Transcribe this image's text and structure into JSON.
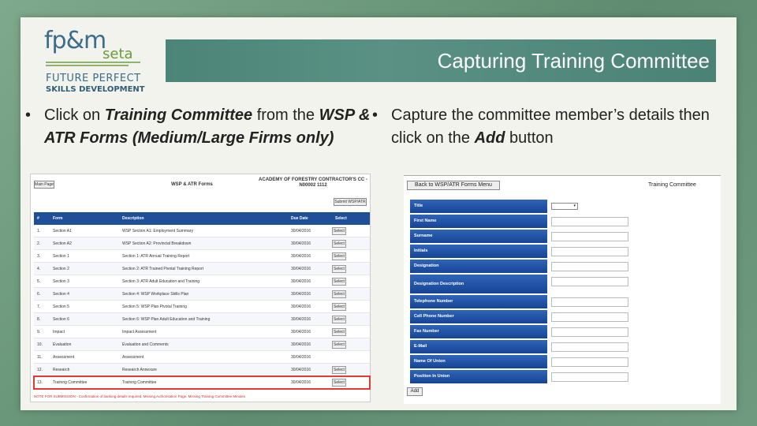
{
  "logo": {
    "brand": "fp&m",
    "seta": "seta",
    "line1": "FUTURE PERFECT",
    "line2": "SKILLS DEVELOPMENT"
  },
  "title": "Capturing Training Committee",
  "bullets": {
    "left": {
      "pre": "Click on ",
      "em1": "Training Committee",
      "mid": " from the ",
      "em2": "WSP & ATR Forms (Medium/Large Firms only)"
    },
    "right": {
      "pre": "Capture the committee member’s details then click on the ",
      "em": "Add",
      "post": " button"
    }
  },
  "left_screen": {
    "main_page_button": "Main Page",
    "header_title": "WSP & ATR Forms",
    "org_name": "ACADEMY OF FORESTRY CONTRACTOR'S CC - N00002 1112",
    "submit_button": "Submit WSP/ATR",
    "columns": [
      "#",
      "Form",
      "Description",
      "Due Date",
      "Select"
    ],
    "rows": [
      {
        "n": "1.",
        "form": "Section A1",
        "desc": "WSP Section A1: Employment Summary",
        "due": "30/04/2016",
        "select": "Select"
      },
      {
        "n": "2.",
        "form": "Section A2",
        "desc": "WSP Section A2: Provincial Breakdown",
        "due": "30/04/2016",
        "select": "Select"
      },
      {
        "n": "3.",
        "form": "Section 1",
        "desc": "Section 1: ATR Annual Training Report",
        "due": "30/04/2016",
        "select": "Select"
      },
      {
        "n": "4.",
        "form": "Section 2",
        "desc": "Section 2: ATR Trained Pivotal Training Report",
        "due": "30/04/2016",
        "select": "Select"
      },
      {
        "n": "5.",
        "form": "Section 3",
        "desc": "Section 3: ATR Adult Education and Training",
        "due": "30/04/2016",
        "select": "Select"
      },
      {
        "n": "6.",
        "form": "Section 4",
        "desc": "Section 4: WSP Workplace Skills Plan",
        "due": "30/04/2016",
        "select": "Select"
      },
      {
        "n": "7.",
        "form": "Section 5",
        "desc": "Section 5: WSP Plan Pivotal Training",
        "due": "30/04/2016",
        "select": "Select"
      },
      {
        "n": "8.",
        "form": "Section 6",
        "desc": "Section 6: WSP Plan Adult Education and Training",
        "due": "30/04/2016",
        "select": "Select"
      },
      {
        "n": "9.",
        "form": "Impact",
        "desc": "Impact Assessment",
        "due": "30/04/2016",
        "select": "Select"
      },
      {
        "n": "10.",
        "form": "Evaluation",
        "desc": "Evaluation and Comments",
        "due": "30/04/2016",
        "select": "Select"
      },
      {
        "n": "11.",
        "form": "Assessment",
        "desc": "Assessment",
        "due": "30/04/2016",
        "select": ""
      },
      {
        "n": "12.",
        "form": "Research",
        "desc": "Research Annexure",
        "due": "30/04/2016",
        "select": "Select"
      },
      {
        "n": "13.",
        "form": "Training Committee",
        "desc": "Training Committee",
        "due": "30/04/2016",
        "select": "Select"
      }
    ],
    "note": "NOTE FOR SUBMISSION - Confirmation of banking details required. Missing Authorisation Page. Missing Training Committee Minutes"
  },
  "right_screen": {
    "back_button": "Back to WSP/ATR Forms Menu",
    "section_title": "Training Committee",
    "fields": [
      "Title",
      "First Name",
      "Surname",
      "Initials",
      "Designation",
      "Designation Description",
      "Telephone Number",
      "Cell Phone Number",
      "Fax Number",
      "E-Mail",
      "Name Of Union",
      "Position In Union"
    ],
    "add_button": "Add"
  }
}
